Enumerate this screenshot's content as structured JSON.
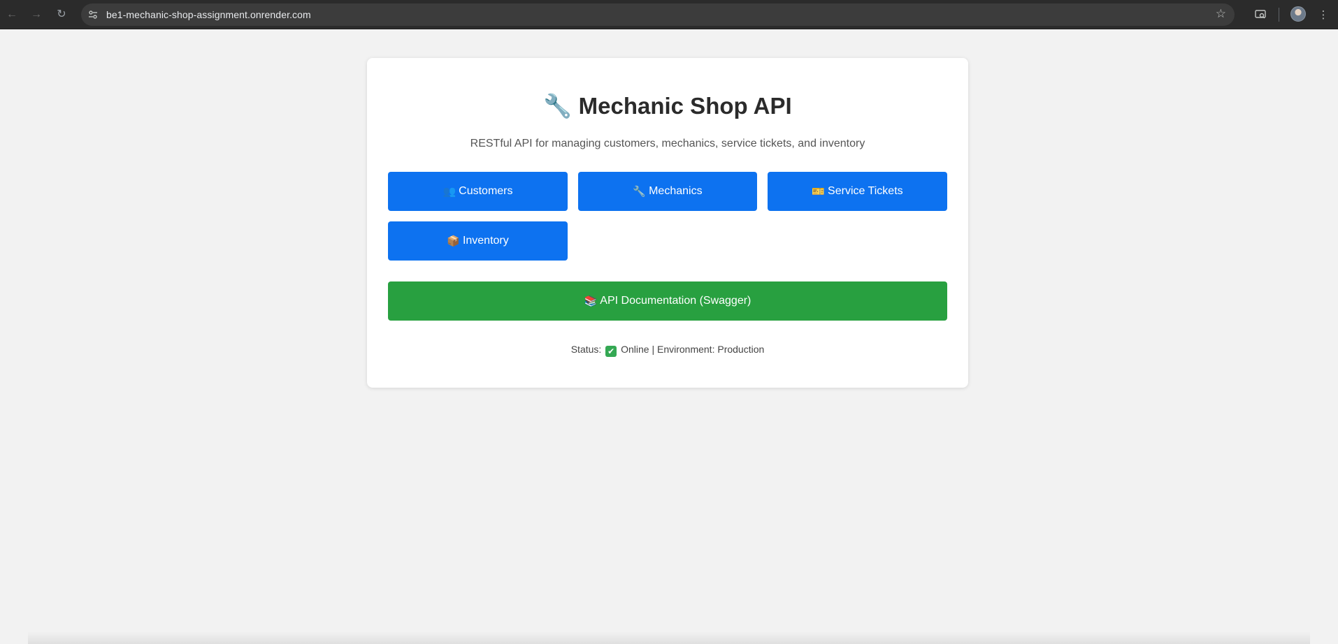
{
  "browser": {
    "url": "be1-mechanic-shop-assignment.onrender.com",
    "back_icon": "←",
    "forward_icon": "→",
    "reload_icon": "↻",
    "star_icon": "☆",
    "menu_icon": "⋮"
  },
  "page": {
    "title_icon": "🔧",
    "title": "Mechanic Shop API",
    "subtitle": "RESTful API for managing customers, mechanics, service tickets, and inventory",
    "buttons": [
      {
        "icon": "👥",
        "label": "Customers"
      },
      {
        "icon": "🔧",
        "label": "Mechanics"
      },
      {
        "icon": "🎫",
        "label": "Service Tickets"
      },
      {
        "icon": "📦",
        "label": "Inventory"
      }
    ],
    "docs_button": {
      "icon": "📚",
      "label": "API Documentation (Swagger)"
    },
    "status": {
      "prefix": "Status:",
      "check": "✔",
      "suffix": "Online | Environment: Production"
    }
  },
  "colors": {
    "primary_button": "#0d72f0",
    "docs_button": "#28a040",
    "status_ok": "#34a853"
  }
}
